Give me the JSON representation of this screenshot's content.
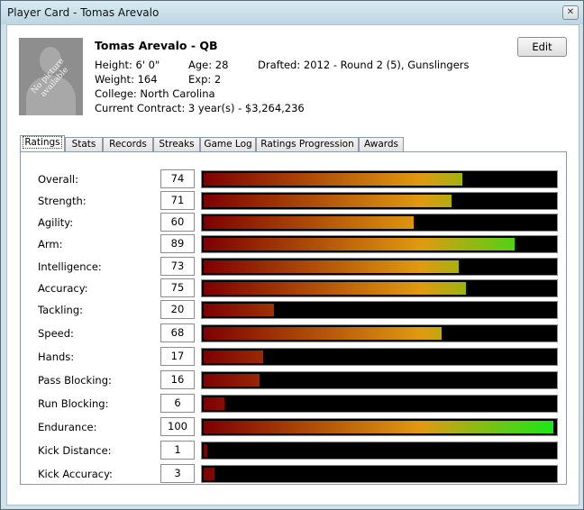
{
  "window": {
    "title": "Player Card - Tomas Arevalo",
    "close_glyph": "✕"
  },
  "player": {
    "name": "Tomas Arevalo - QB",
    "photo_placeholder": "No picture available",
    "height": "Height: 6' 0\"",
    "age": "Age: 28",
    "drafted": "Drafted: 2012 - Round 2 (5), Gunslingers",
    "weight": "Weight: 164",
    "exp": "Exp: 2",
    "college": "College: North Carolina",
    "contract": "Current Contract: 3 year(s) - $3,264,236"
  },
  "edit_label": "Edit",
  "tabs": [
    {
      "label": "Ratings",
      "active": true
    },
    {
      "label": "Stats"
    },
    {
      "label": "Records"
    },
    {
      "label": "Streaks"
    },
    {
      "label": "Game Log"
    },
    {
      "label": "Ratings Progression"
    },
    {
      "label": "Awards"
    }
  ],
  "ratings": [
    {
      "label": "Overall:",
      "value": 74
    },
    {
      "label": "Strength:",
      "value": 71
    },
    {
      "label": "Agility:",
      "value": 60
    },
    {
      "label": "Arm:",
      "value": 89
    },
    {
      "label": "Intelligence:",
      "value": 73
    },
    {
      "label": "Accuracy:",
      "value": 75
    },
    {
      "label": "Tackling:",
      "value": 20
    },
    {
      "label": "Speed:",
      "value": 68
    },
    {
      "label": "Hands:",
      "value": 17
    },
    {
      "label": "Pass Blocking:",
      "value": 16
    },
    {
      "label": "Run Blocking:",
      "value": 6
    },
    {
      "label": "Endurance:",
      "value": 100
    },
    {
      "label": "Kick Distance:",
      "value": 1
    },
    {
      "label": "Kick Accuracy:",
      "value": 3
    }
  ],
  "rating_max": 100,
  "colors": {
    "bar_low": "#7d0000",
    "bar_mid": "#e09a10",
    "bar_high": "#18e818",
    "bar_track": "#000000"
  }
}
